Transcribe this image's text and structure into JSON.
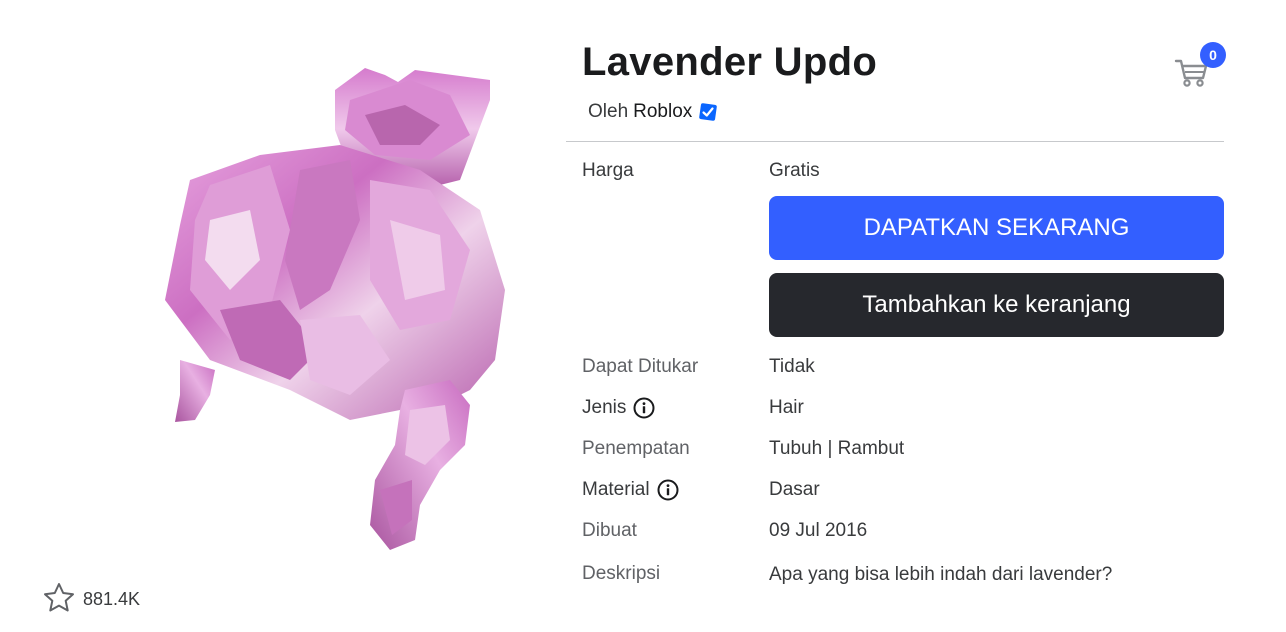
{
  "item": {
    "title": "Lavender Updo",
    "by_label": "Oleh",
    "creator": "Roblox",
    "favorites": "881.4K"
  },
  "cart": {
    "count": "0"
  },
  "details": {
    "price_label": "Harga",
    "price_value": "Gratis",
    "buy_button": "DAPATKAN SEKARANG",
    "add_to_cart_button": "Tambahkan ke keranjang",
    "rows": [
      {
        "label": "Dapat Ditukar",
        "value": "Tidak"
      },
      {
        "label": "Jenis",
        "value": "Hair"
      },
      {
        "label": "Penempatan",
        "value": "Tubuh | Rambut"
      },
      {
        "label": "Material",
        "value": "Dasar"
      },
      {
        "label": "Dibuat",
        "value": "09 Jul 2016"
      },
      {
        "label": "Deskripsi",
        "value": "Apa yang bisa lebih indah dari lavender?"
      }
    ]
  },
  "colors": {
    "primary": "#335fff",
    "secondary": "#26282d",
    "hair_light": "#e9a6e2",
    "hair_mid": "#cf78c6",
    "hair_dark": "#a85a9f"
  },
  "icons": {
    "cart": "shopping-cart-icon",
    "verified": "verified-badge-icon",
    "info": "info-icon",
    "favorite": "star-outline-icon"
  }
}
